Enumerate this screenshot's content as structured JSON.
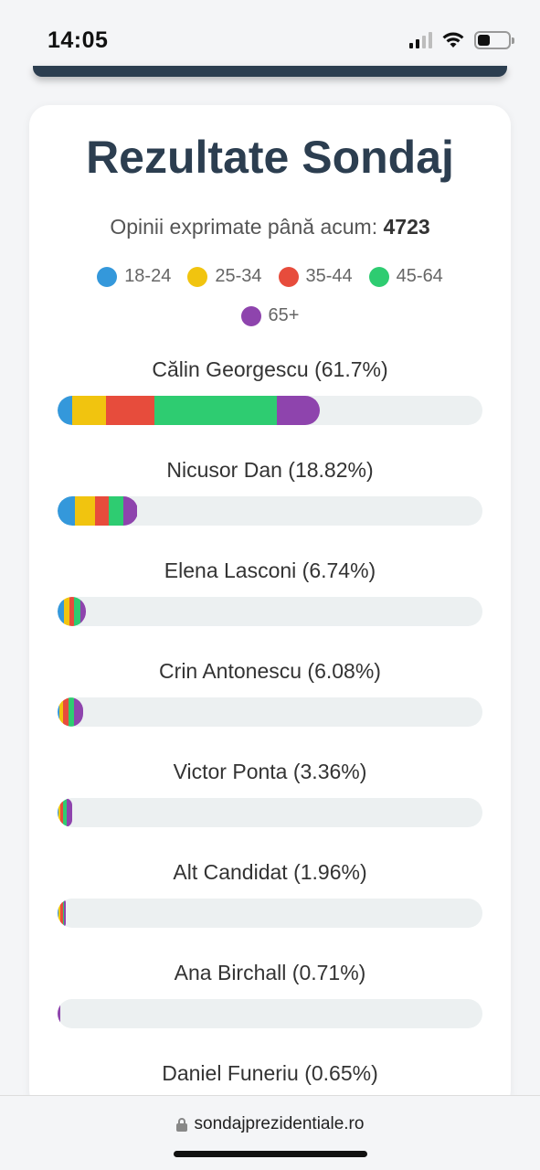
{
  "status": {
    "time": "14:05"
  },
  "page": {
    "title": "Rezultate Sondaj",
    "votes_label": "Opinii exprimate până acum: ",
    "votes_count": "4723"
  },
  "colors": {
    "18-24": "#3498db",
    "25-34": "#f1c40f",
    "35-44": "#e74c3c",
    "45-64": "#2ecc71",
    "65+": "#8e44ad"
  },
  "legend": [
    "18-24",
    "25-34",
    "35-44",
    "45-64",
    "65+"
  ],
  "candidates": [
    {
      "label": "Călin Georgescu (61.7%)",
      "percent": 61.7,
      "segments": [
        3.5,
        7.8,
        11.6,
        28.8,
        10.0
      ]
    },
    {
      "label": "Nicusor Dan (18.82%)",
      "percent": 18.82,
      "segments": [
        4.1,
        4.8,
        3.2,
        3.4,
        3.32
      ]
    },
    {
      "label": "Elena Lasconi (6.74%)",
      "percent": 6.74,
      "segments": [
        1.5,
        1.3,
        1.1,
        1.4,
        1.44
      ]
    },
    {
      "label": "Crin Antonescu (6.08%)",
      "percent": 6.08,
      "segments": [
        0.4,
        0.9,
        1.2,
        1.3,
        2.28
      ]
    },
    {
      "label": "Victor Ponta (3.36%)",
      "percent": 3.36,
      "segments": [
        0.2,
        0.4,
        0.7,
        0.8,
        1.26
      ]
    },
    {
      "label": "Alt Candidat (1.96%)",
      "percent": 1.96,
      "segments": [
        0.3,
        0.4,
        0.5,
        0.4,
        0.36
      ]
    },
    {
      "label": "Ana Birchall (0.71%)",
      "percent": 0.71,
      "segments": [
        0,
        0,
        0,
        0,
        0.71
      ]
    },
    {
      "label": "Daniel Funeriu (0.65%)",
      "percent": 0.65,
      "segments": [
        0.1,
        0.1,
        0.15,
        0.15,
        0.15
      ]
    }
  ],
  "browser": {
    "url": "sondajprezidentiale.ro"
  }
}
